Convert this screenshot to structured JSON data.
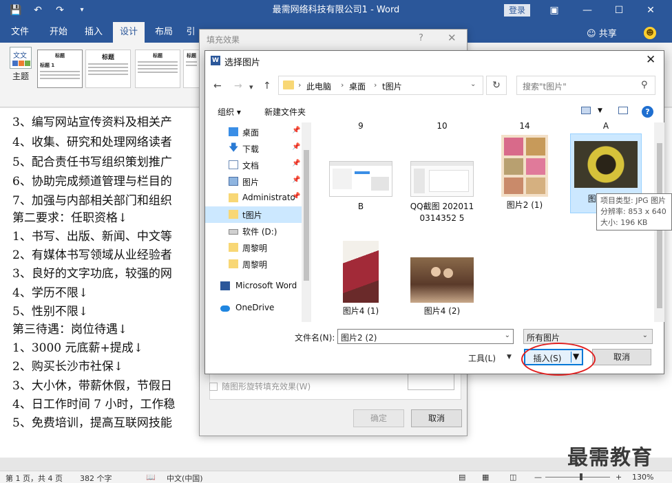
{
  "word": {
    "doc_title": "最需网络科技有限公司1 - Word",
    "login": "登录",
    "tabs": [
      "文件",
      "开始",
      "插入",
      "设计",
      "布局",
      "引"
    ],
    "active_tab": "设计",
    "share": "共享",
    "theme_label": "主题",
    "style_thumbs": [
      "标题",
      "标题",
      "标题",
      "标题",
      "标题",
      "标题"
    ],
    "thumb_subtitle": "标题 1",
    "colors": {
      "brand": "#2b579a",
      "selection": "#cce8ff",
      "accent_ring": "#e02020"
    }
  },
  "document": {
    "lines": [
      "3、编写网站宣传资料及相关产",
      "4、收集、研究和处理网络读者",
      "5、配合责任书写组织策划推广",
      "6、协助完成频道管理与栏目的",
      "7、加强与内部相关部门和组织",
      "第二要求：任职资格↓",
      "1、书写、出版、新闻、中文等",
      "2、有媒体书写领域从业经验者",
      "3、良好的文字功底，较强的网",
      "4、学历不限↓",
      "5、性别不限↓",
      "第三待遇：岗位待遇↓",
      "1、3000 元底薪+提成↓",
      "2、购买长沙市社保↓",
      "3、大小休，带薪休假，节假日",
      "4、日工作时间 7 小时，工作稳",
      "5、免费培训，提高互联网技能"
    ]
  },
  "statusbar": {
    "page": "第 1 页，共 4 页",
    "words": "382 个字",
    "lang": "中文(中国)",
    "zoom": "130%"
  },
  "watermark": "最需教育",
  "fill_dialog": {
    "title": "填充效果",
    "rotate_label": "随图形旋转填充效果(W)",
    "ok": "确定",
    "cancel": "取消"
  },
  "picker": {
    "title": "选择图片",
    "breadcrumb": [
      "此电脑",
      "桌面",
      "t图片"
    ],
    "search_placeholder": "搜索\"t图片\"",
    "organize": "组织 ▾",
    "new_folder": "新建文件夹",
    "nav_items": [
      {
        "label": "桌面",
        "icon": "desktop-icon",
        "pinned": true
      },
      {
        "label": "下载",
        "icon": "download-icon",
        "pinned": true
      },
      {
        "label": "文档",
        "icon": "document-icon",
        "pinned": true
      },
      {
        "label": "图片",
        "icon": "pictures-icon",
        "pinned": true
      },
      {
        "label": "Administrato",
        "icon": "folder-icon",
        "pinned": true
      },
      {
        "label": "t图片",
        "icon": "folder-icon",
        "pinned": false,
        "selected": true
      },
      {
        "label": "软件 (D:)",
        "icon": "drive-icon",
        "pinned": false
      },
      {
        "label": "周黎明",
        "icon": "folder-icon",
        "pinned": false
      },
      {
        "label": "周黎明",
        "icon": "folder-icon",
        "pinned": false
      },
      {
        "label": "Microsoft Word",
        "icon": "word-icon",
        "pinned": false
      },
      {
        "label": "OneDrive",
        "icon": "onedrive-icon",
        "pinned": false
      }
    ],
    "top_partial_labels": [
      "9",
      "10",
      "14",
      "A"
    ],
    "files": [
      {
        "label": "B",
        "kind": "screenshot"
      },
      {
        "label": "QQ截图 2020110314352 5",
        "kind": "screenshot2"
      },
      {
        "label": "图片2 (1)",
        "kind": "collage"
      },
      {
        "label": "图片2 (2)",
        "kind": "wreath",
        "selected": true
      },
      {
        "label": "图片4 (1)",
        "kind": "photo-red"
      },
      {
        "label": "图片4 (2)",
        "kind": "photo-people"
      }
    ],
    "tooltip": {
      "type": "项目类型: JPG 图片",
      "resolution": "分辨率: 853 x 640",
      "size": "大小: 196 KB"
    },
    "filename_label": "文件名(N):",
    "filename_value": "图片2 (2)",
    "filetype_value": "所有图片",
    "tools": "工具(L)",
    "insert": "插入(S)",
    "cancel": "取消"
  }
}
